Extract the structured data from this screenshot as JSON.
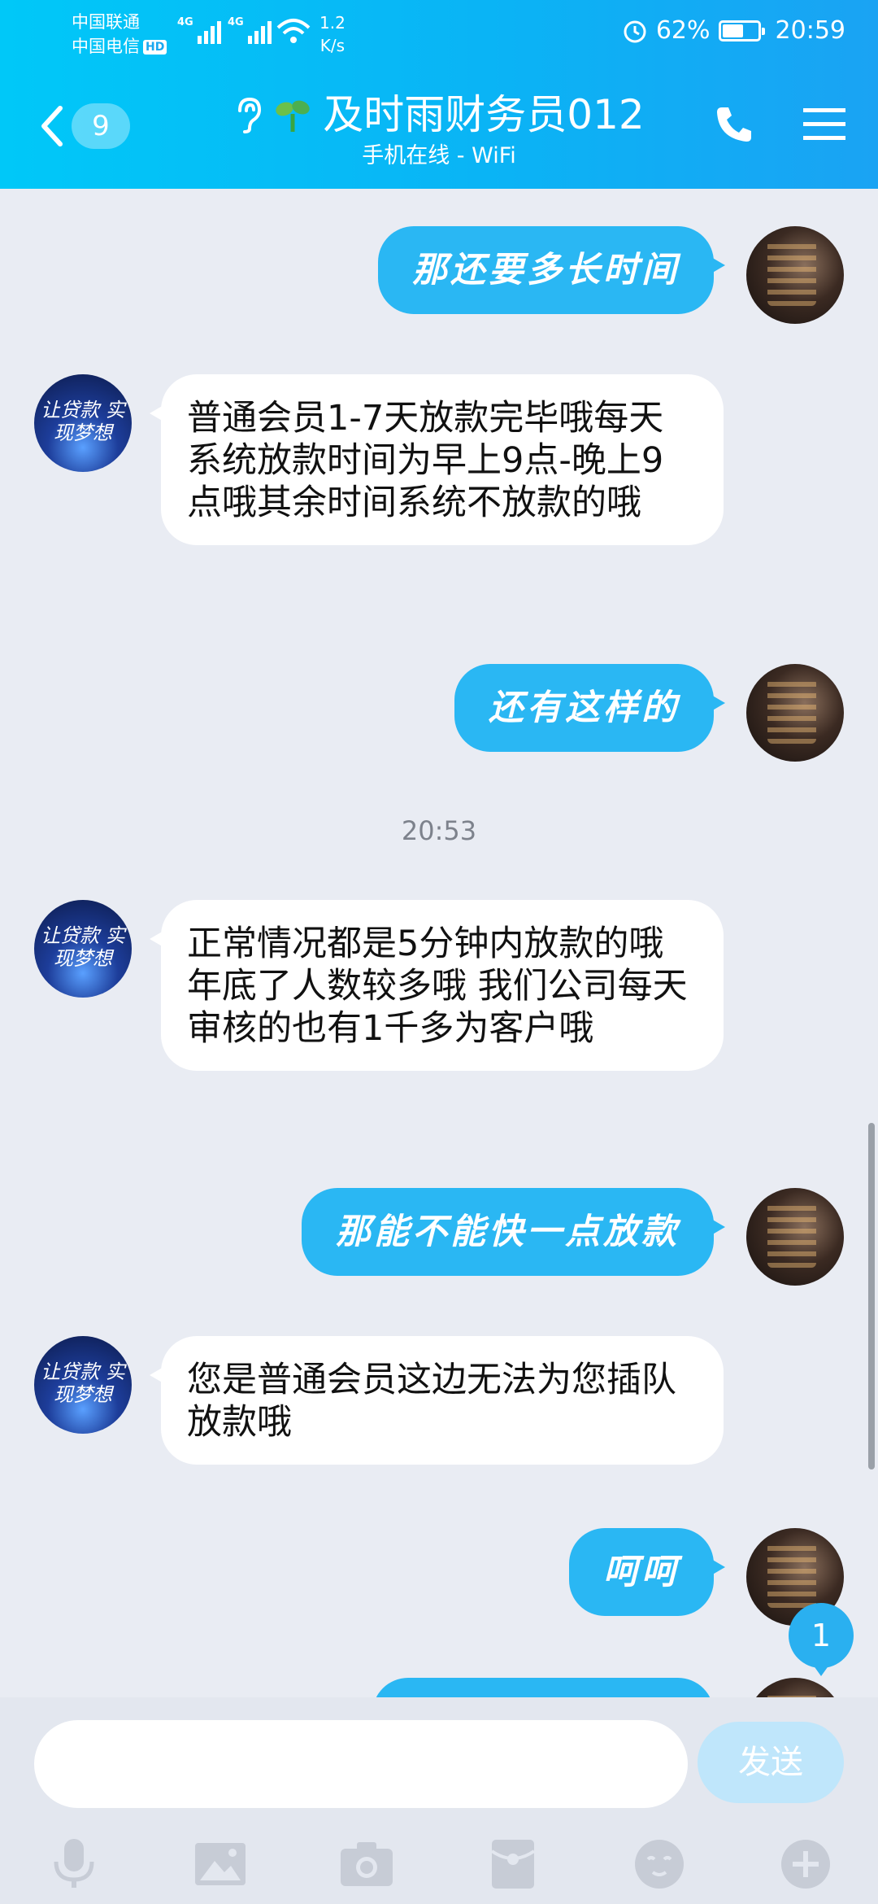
{
  "status_bar": {
    "carrier1": "中国联通",
    "carrier2": "中国电信",
    "hd": "HD",
    "net1": "4G",
    "net2": "4G",
    "speed_value": "1.2",
    "speed_unit": "K/s",
    "battery": "62%",
    "battery_level": 0.62,
    "time": "20:59"
  },
  "header": {
    "back_badge": "9",
    "title": "及时雨财务员012",
    "subtitle": "手机在线 - WiFi",
    "background_color": "#0ab4f5"
  },
  "avatars": {
    "bot_text": "让贷款 实现梦想"
  },
  "messages": [
    {
      "from": "me",
      "text": "那还要多长时间"
    },
    {
      "from": "bot",
      "text": "普通会员1-7天放款完毕哦每天系统放款时间为早上9点-晚上9点哦其余时间系统不放款的哦"
    },
    {
      "from": "me",
      "text": "还有这样的"
    },
    {
      "from": "bot",
      "text": "正常情况都是5分钟内放款的哦  年底了人数较多哦 我们公司每天审核的也有1千多为客户哦"
    },
    {
      "from": "me",
      "text": "那能不能快一点放款"
    },
    {
      "from": "bot",
      "text": "您是普通会员这边无法为您插队放款哦"
    },
    {
      "from": "me",
      "text": "呵呵"
    }
  ],
  "timestamp": "20:53",
  "new_message_badge": "1",
  "input": {
    "value": "",
    "send_label": "发送"
  },
  "toolbar": {
    "icons": [
      "microphone-icon",
      "image-icon",
      "camera-icon",
      "red-packet-icon",
      "emoji-icon",
      "plus-icon"
    ]
  },
  "colors": {
    "bubble_out": "#2ab7f3",
    "bubble_in": "#ffffff",
    "chat_bg": "#e9ecf3"
  }
}
